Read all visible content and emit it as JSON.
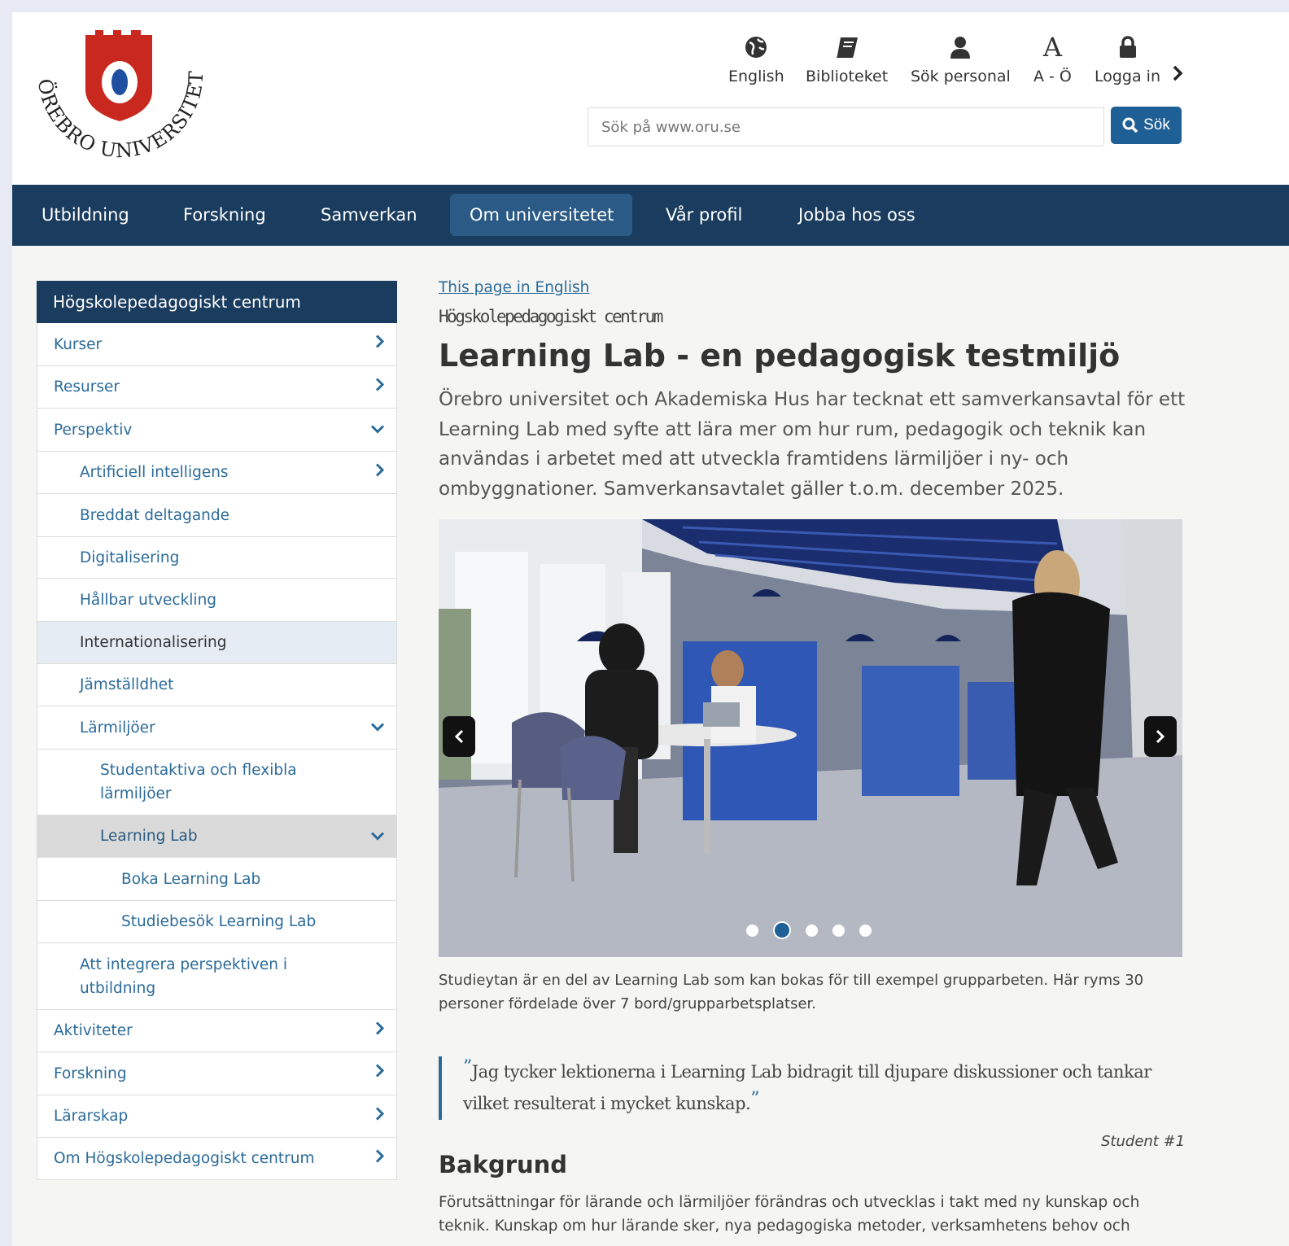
{
  "header": {
    "logo_text": "ÖREBRO UNIVERSITET",
    "utility_links": [
      {
        "label": "English",
        "icon": "globe-icon"
      },
      {
        "label": "Biblioteket",
        "icon": "book-icon"
      },
      {
        "label": "Sök personal",
        "icon": "user-icon"
      },
      {
        "label": "A - Ö",
        "icon": "a-letter-icon"
      },
      {
        "label": "Logga in",
        "icon": "lock-icon"
      }
    ],
    "search": {
      "placeholder": "Sök på www.oru.se",
      "button_label": "Sök"
    }
  },
  "nav": {
    "items": [
      {
        "label": "Utbildning"
      },
      {
        "label": "Forskning"
      },
      {
        "label": "Samverkan"
      },
      {
        "label": "Om universitetet",
        "active": true
      },
      {
        "label": "Vår profil"
      },
      {
        "label": "Jobba hos oss"
      }
    ]
  },
  "sidebar": {
    "title": "Högskolepedagogiskt centrum",
    "items": [
      {
        "label": "Kurser"
      },
      {
        "label": "Resurser"
      },
      {
        "label": "Perspektiv"
      },
      {
        "label": "Artificiell intelligens"
      },
      {
        "label": "Breddat deltagande"
      },
      {
        "label": "Digitalisering"
      },
      {
        "label": "Hållbar utveckling"
      },
      {
        "label": "Internationalisering"
      },
      {
        "label": "Jämställdhet"
      },
      {
        "label": "Lärmiljöer"
      },
      {
        "label": "Studentaktiva och flexibla lärmiljöer"
      },
      {
        "label": "Learning Lab"
      },
      {
        "label": "Boka Learning Lab"
      },
      {
        "label": "Studiebesök Learning Lab"
      },
      {
        "label": "Att integrera perspektiven i utbildning"
      },
      {
        "label": "Aktiviteter"
      },
      {
        "label": "Forskning"
      },
      {
        "label": "Lärarskap"
      },
      {
        "label": "Om Högskolepedagogiskt centrum"
      }
    ]
  },
  "main": {
    "lang_link": "This page in English",
    "department": "Högskolepedagogiskt centrum",
    "title": "Learning Lab - en pedagogisk testmiljö",
    "lead": "Örebro universitet och Akademiska Hus har tecknat ett samverkansavtal för ett Learning Lab med syfte att lära mer om hur rum, pedagogik och teknik kan användas i arbetet med att utveckla framtidens lärmiljöer i ny- och ombyggnationer. Samverkansavtalet gäller t.o.m. december 2025.",
    "carousel": {
      "slide_count": 5,
      "active_slide": 2
    },
    "caption": "Studieytan är en del av Learning Lab som kan bokas för till exempel grupparbeten. Här ryms 30 personer fördelade över 7 bord/grupparbetsplatser.",
    "quote": {
      "text": "Jag tycker lektionerna i Learning Lab bidragit till djupare diskussioner och tankar vilket resulterat i mycket kunskap.",
      "author": "Student #1"
    },
    "section_title": "Bakgrund",
    "body": "Förutsättningar för lärande och lärmiljöer förändras och utvecklas i takt med ny kunskap och teknik. Kunskap om hur lärande sker, nya pedagogiska metoder, verksamhetens behov och"
  },
  "colors": {
    "brand_navy": "#1a3c5e",
    "link_blue": "#2b6b9a",
    "button_blue": "#1e5f95",
    "logo_red": "#c8281e"
  }
}
